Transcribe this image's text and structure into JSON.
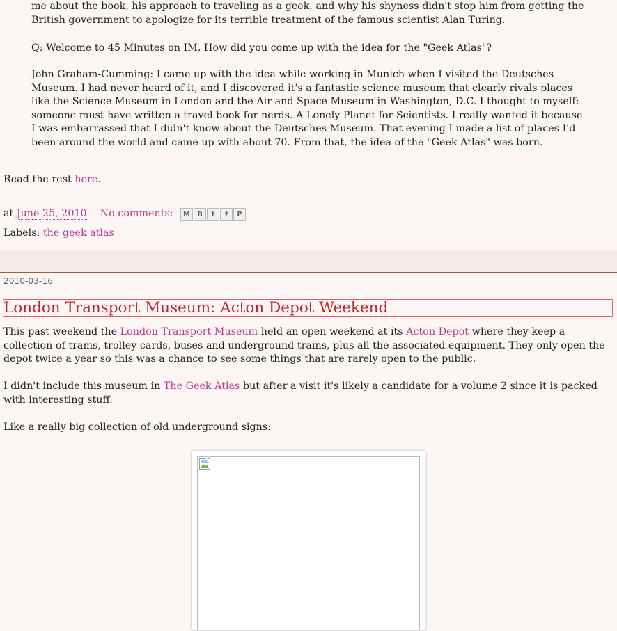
{
  "previous_post": {
    "intro_tail": "me about the book, his approach to traveling as a geek, and why his shyness didn't stop him from getting the British government to apologize for its terrible treatment of the famous scientist Alan Turing.",
    "question": "Q: Welcome to 45 Minutes on IM. How did you come up with the idea for the \"Geek Atlas\"?",
    "answer": "John Graham-Cumming: I came up with the idea while working in Munich when I visited the Deutsches Museum. I had never heard of it, and I discovered it's a fantastic science museum that clearly rivals places like the Science Museum in London and the Air and Space Museum in Washington, D.C. I thought to myself: someone must have written a travel book for nerds. A Lonely Planet for Scientists. I really wanted it because I was embarrassed that I didn't know about the Deutsches Museum. That evening I made a list of places I'd been around the world and came up with about 70. From that, the idea of the \"Geek Atlas\" was born.",
    "read_rest_prefix": "Read the rest ",
    "read_rest_link": "here",
    "read_rest_suffix": ".",
    "footer": {
      "at": "at ",
      "date": "June 25, 2010",
      "comments": "No comments:",
      "labels_prefix": "Labels: ",
      "label": "the geek atlas"
    },
    "share_icons": [
      "email-icon",
      "blogger-icon",
      "twitter-icon",
      "facebook-icon",
      "pinterest-icon"
    ]
  },
  "post": {
    "date": "2010-03-16",
    "title": "London Transport Museum: Acton Depot Weekend",
    "p1": {
      "a": "This past weekend the ",
      "link1": "London Transport Museum",
      "b": " held an open weekend at its ",
      "link2": "Acton Depot",
      "c": " where they keep a collection of trams, trolley cards, buses and underground trains, plus all the associated equipment. They only open the depot twice a year so this was a chance to see some things that are rarely open to the public."
    },
    "p2": {
      "a": "I didn't include this museum in ",
      "link": "The Geek Atlas",
      "b": " but after a visit it's likely a candidate for a volume 2 since it is packed with interesting stuff."
    },
    "p3": "Like a really big collection of old underground signs:"
  },
  "colors": {
    "background": "#fcf6f5",
    "link": "#b73a8f",
    "title": "#c02530",
    "separator": "#a75a45"
  }
}
